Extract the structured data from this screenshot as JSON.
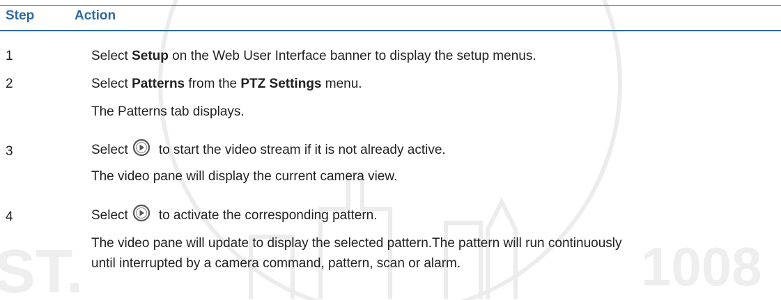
{
  "header": {
    "col_step": "Step",
    "col_action": "Action"
  },
  "steps": [
    {
      "num": "1",
      "pre": "Select ",
      "bold1": "Setup",
      "post": " on the Web User Interface banner to display the setup menus."
    },
    {
      "num": "2",
      "pre": "Select ",
      "bold1": "Patterns",
      "mid": " from the ",
      "bold2": "PTZ Settings",
      "post": " menu.",
      "note": "The Patterns tab displays."
    },
    {
      "num": "3",
      "pre": "Select",
      "icon": "play-circle-icon",
      "post": "to start the video stream if it is not already active.",
      "note": "The video pane will display the current camera view."
    },
    {
      "num": "4",
      "pre": "Select",
      "icon": "play-circle-icon",
      "post": "to activate the corresponding pattern.",
      "note_line1": "The video pane will update to display the selected pattern.The pattern will run continuously",
      "note_line2": "until interrupted by a camera command, pattern, scan or alarm."
    }
  ],
  "watermark": {
    "text_left": "ST.",
    "text_right": "1008",
    "color": "#e6e6e6"
  }
}
